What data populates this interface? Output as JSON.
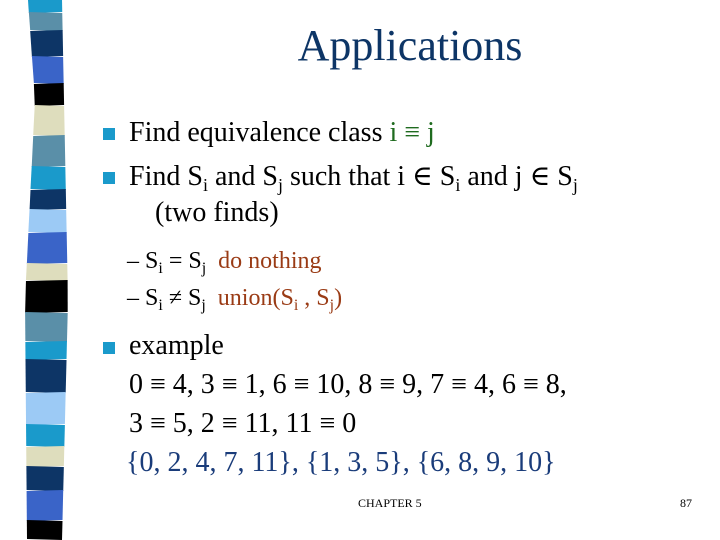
{
  "slide": {
    "title": "Applications",
    "colors": {
      "title": "#0d3566",
      "bullet": "#1a9acb",
      "equivalence_highlight": "#1f6b1f",
      "action_highlight": "#9a3b15",
      "result_highlight": "#1a3c7a"
    },
    "decoration": {
      "stripe_colors": [
        "#1a9acb",
        "#5a8fa8",
        "#0d3566",
        "#3a64c8",
        "#000000",
        "#deddbd",
        "#5a8fa8",
        "#1a9acb",
        "#0d3566",
        "#9ccaf5",
        "#3a64c8",
        "#deddbd",
        "#000000",
        "#5a8fa8",
        "#1a9acb",
        "#0d3566",
        "#9ccaf5",
        "#1a9acb",
        "#deddbd",
        "#0d3566",
        "#3a64c8",
        "#000000"
      ]
    },
    "bullets": [
      {
        "text": "Find equivalence class ",
        "highlight": "i ≡ j"
      },
      {
        "part1": "Find S",
        "sub1": "i",
        "part2": " and S",
        "sub2": "j",
        "part3": " such that i ∈ S",
        "sub3": "i",
        "part4": " and j ∈ S",
        "sub4": "j",
        "continuation": "(two finds)"
      }
    ],
    "sub_bullets": [
      {
        "dash": "–",
        "lhs": "S",
        "lhs_sub": "i",
        "op": " = S",
        "rhs_sub": "j",
        "action": "do nothing"
      },
      {
        "dash": "–",
        "lhs": "S",
        "lhs_sub": "i",
        "op": " ≠ S",
        "rhs_sub": "j",
        "action_pre": "union(S",
        "action_sub1": "i",
        "action_mid": " , S",
        "action_sub2": "j",
        "action_post": ")"
      }
    ],
    "example": {
      "label": "example",
      "line1": "0 ≡ 4, 3 ≡ 1, 6 ≡ 10, 8 ≡ 9, 7 ≡ 4, 6 ≡ 8,",
      "line2": "3 ≡ 5, 2 ≡ 11, 11 ≡ 0",
      "result": "{0, 2, 4, 7, 11}, {1, 3, 5}, {6, 8, 9, 10}"
    },
    "footer": {
      "chapter": "CHAPTER 5",
      "page": "87"
    }
  }
}
